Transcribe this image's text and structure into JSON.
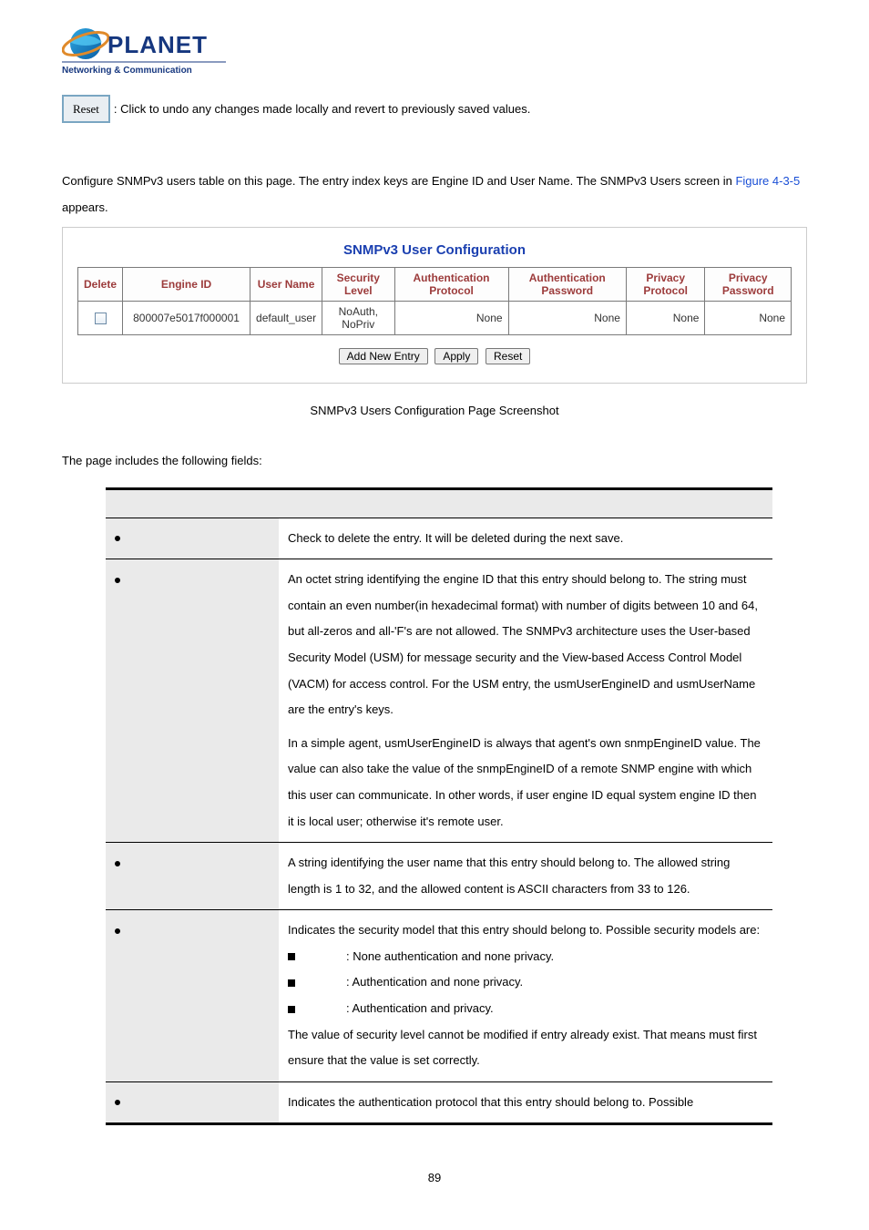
{
  "logo": {
    "name": "PLANET",
    "tagline": "Networking & Communication"
  },
  "reset_btn_label": "Reset",
  "reset_desc": ": Click to undo any changes made locally and revert to previously saved values.",
  "intro_text_a": "Configure SNMPv3 users table on this page. The entry index keys are Engine ID and User Name. The SNMPv3 Users screen in ",
  "intro_link": "Figure 4-3-5",
  "intro_text_b": " appears.",
  "snmp_panel": {
    "title": "SNMPv3 User Configuration",
    "headers": [
      "Delete",
      "Engine ID",
      "User Name",
      "Security Level",
      "Authentication Protocol",
      "Authentication Password",
      "Privacy Protocol",
      "Privacy Password"
    ],
    "row": {
      "engine_id": "800007e5017f000001",
      "user_name": "default_user",
      "security_level": "NoAuth, NoPriv",
      "auth_protocol": "None",
      "auth_password": "None",
      "priv_protocol": "None",
      "priv_password": "None"
    },
    "buttons": {
      "add": "Add New Entry",
      "apply": "Apply",
      "reset": "Reset"
    }
  },
  "caption": "SNMPv3 Users Configuration Page Screenshot",
  "fields_intro": "The page includes the following fields:",
  "fields": {
    "delete_desc": "Check to delete the entry. It will be deleted during the next save.",
    "engine_p1": "An octet string identifying the engine ID that this entry should belong to. The string must contain an even number(in hexadecimal format) with number of digits between 10 and 64, but all-zeros and all-'F's are not allowed. The SNMPv3 architecture uses the User-based Security Model (USM) for message security and the View-based Access Control Model (VACM) for access control. For the USM entry, the usmUserEngineID and usmUserName are the entry's keys.",
    "engine_p2": "In a simple agent, usmUserEngineID is always that agent's own snmpEngineID value. The value can also take the value of the snmpEngineID of a remote SNMP engine with which this user can communicate. In other words, if user engine ID equal system engine ID then it is local user; otherwise it's remote user.",
    "username_desc": "A string identifying the user name that this entry should belong to. The allowed string length is 1 to 32, and the allowed content is ASCII characters from 33 to 126.",
    "seclevel_intro": "Indicates the security model that this entry should belong to. Possible security models are:",
    "seclevel_items": [
      ": None authentication and none privacy.",
      ": Authentication and none privacy.",
      ": Authentication and privacy."
    ],
    "seclevel_note": "The value of security level cannot be modified if entry already exist. That means must first ensure that the value is set correctly.",
    "authproto_desc": "Indicates the authentication protocol that this entry should belong to. Possible"
  },
  "page_number": "89"
}
